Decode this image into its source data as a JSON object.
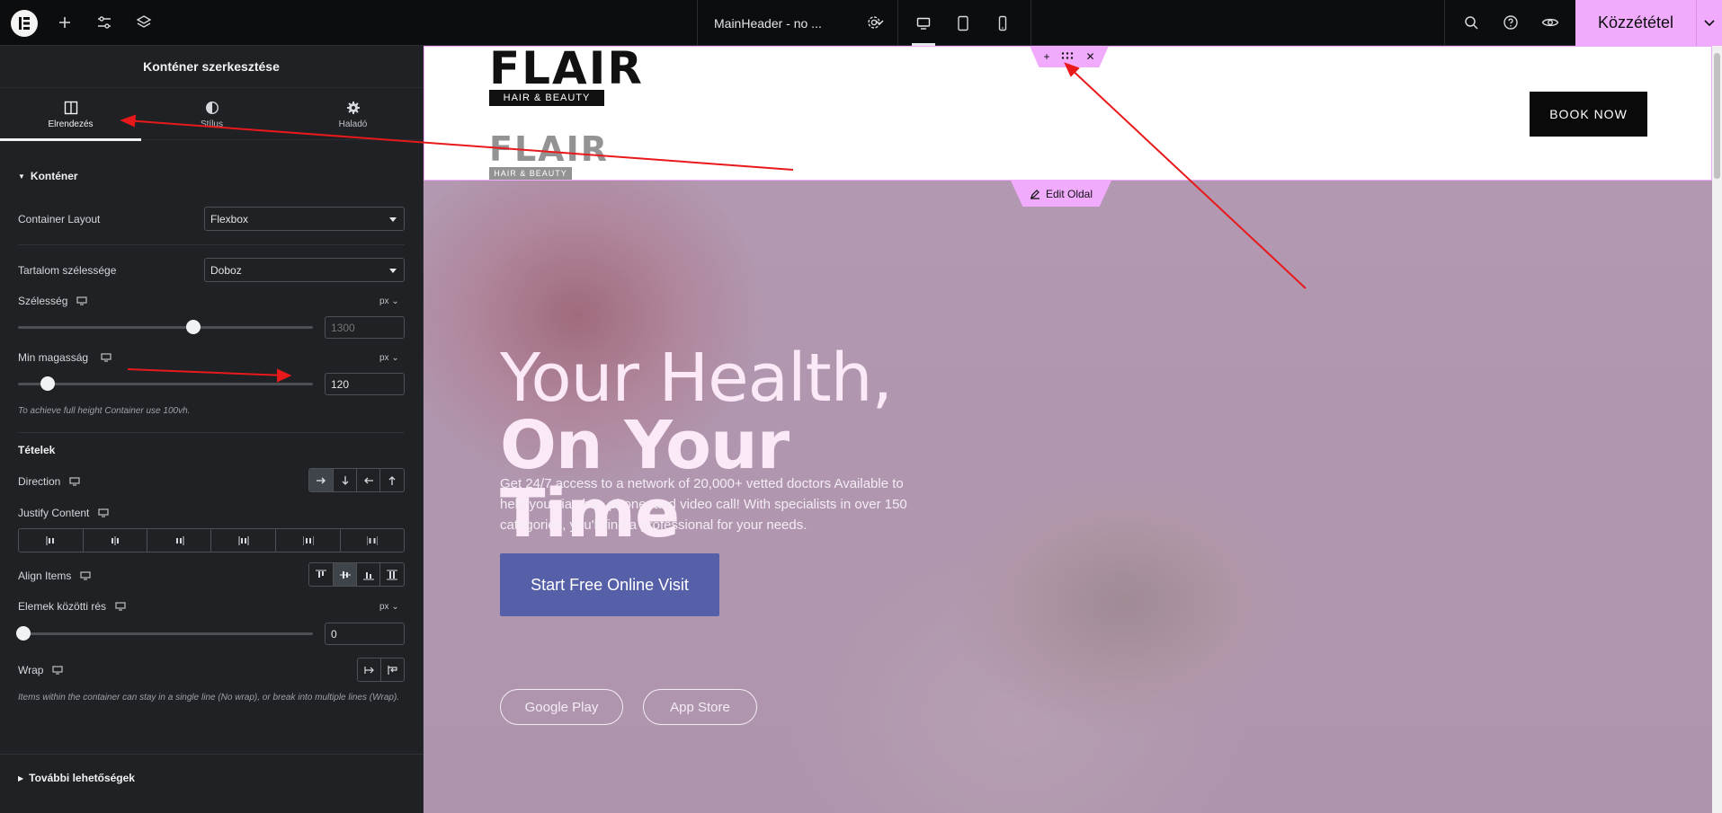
{
  "topbar": {
    "doc_name": "MainHeader - no ...",
    "publish_label": "Közzététel",
    "icons": [
      "elementor-logo-icon",
      "plus-icon",
      "sliders-icon",
      "layers-icon",
      "chevron-down-icon",
      "gear-icon",
      "desktop-icon",
      "tablet-icon",
      "mobile-icon",
      "search-icon",
      "help-icon",
      "eye-icon"
    ]
  },
  "panel": {
    "title": "Konténer szerkesztése",
    "tabs": [
      {
        "label": "Elrendezés",
        "icon": "layout-icon"
      },
      {
        "label": "Stílus",
        "icon": "contrast-icon"
      },
      {
        "label": "Haladó",
        "icon": "gear-icon"
      }
    ],
    "section_container": "Konténer",
    "container_layout": {
      "label": "Container Layout",
      "value": "Flexbox"
    },
    "content_width": {
      "label": "Tartalom szélessége",
      "value": "Doboz"
    },
    "width": {
      "label": "Szélesség",
      "unit": "px",
      "placeholder": "1300",
      "slider_level": 0.6
    },
    "min_height": {
      "label": "Min magasság",
      "unit": "px",
      "value": "120",
      "slider_level": 0.08
    },
    "min_height_hint": "To achieve full height Container use 100vh.",
    "section_items": "Tételek",
    "direction_label": "Direction",
    "justify_label": "Justify Content",
    "align_label": "Align Items",
    "gap": {
      "label": "Elemek közötti rés",
      "unit": "px",
      "value": "0"
    },
    "wrap_label": "Wrap",
    "wrap_hint": "Items within the container can stay in a single line (No wrap), or break into multiple lines (Wrap).",
    "more_options": "További lehetőségek"
  },
  "canvas": {
    "logo_word": "FLAIR",
    "logo_sub": "HAIR & BEAUTY",
    "book_now": "BOOK NOW",
    "edit_tab": "Edit Oldal",
    "hero_line1": "Your Health,",
    "hero_line2": "On Your",
    "hero_line3": "Time",
    "hero_paragraph": "Get 24/7 access to a network of 20,000+ vetted doctors Available to help you via chat, phone, and video call! With specialists in over 150 categories, you'll find a professional for your needs.",
    "cta": "Start Free Online Visit",
    "google_play": "Google Play",
    "app_store": "App Store"
  },
  "colors": {
    "accent_pink": "#f0abfc",
    "panel_bg": "#1f2124",
    "topbar_bg": "#0c0d0e",
    "cta_blue": "#5660a8",
    "annotation_red": "#e8191b"
  }
}
